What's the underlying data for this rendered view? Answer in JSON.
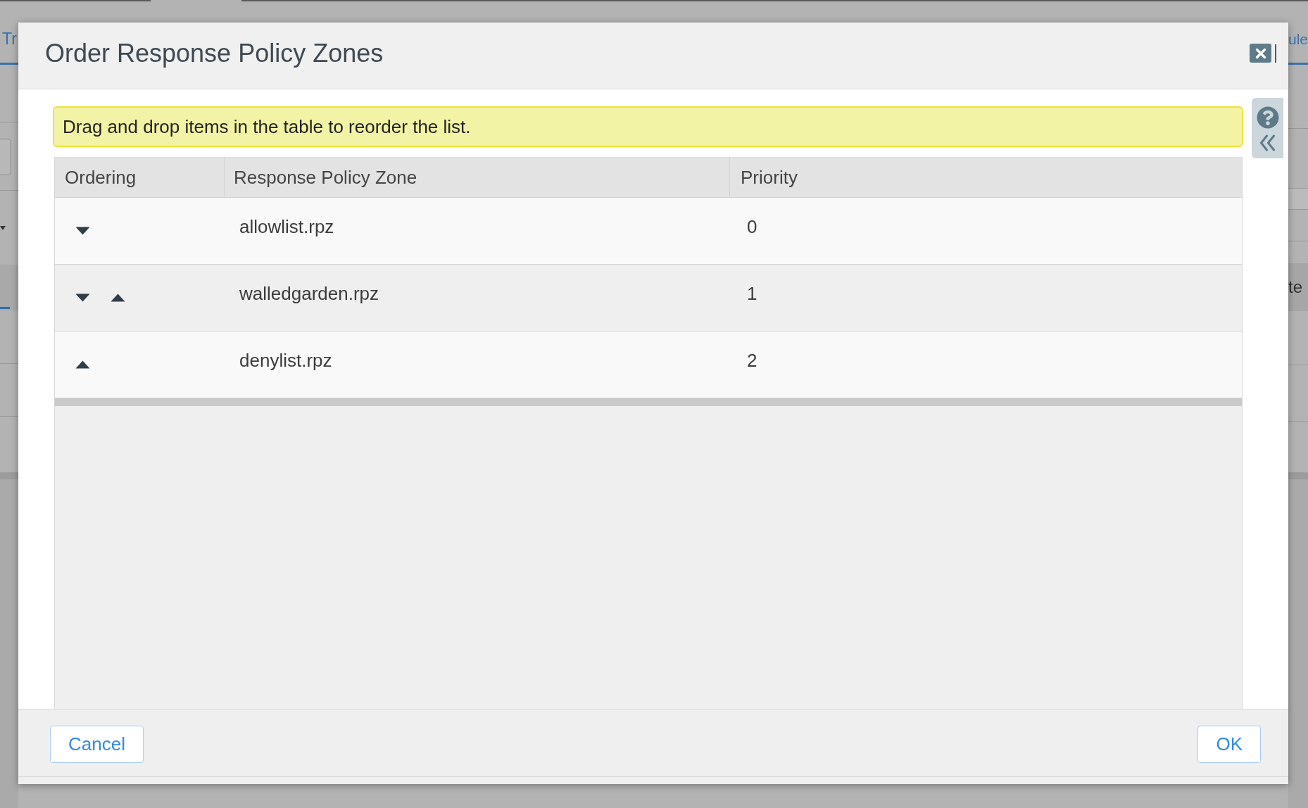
{
  "background": {
    "left_tab": "Tr",
    "right_tab": "ule",
    "right_cell": "te"
  },
  "dialog": {
    "title": "Order Response Policy Zones",
    "banner": "Drag and drop items in the table to reorder the list.",
    "table": {
      "columns": [
        "Ordering",
        "Response Policy Zone",
        "Priority"
      ],
      "rows": [
        {
          "can_move_down": true,
          "can_move_up": false,
          "zone": "allowlist.rpz",
          "priority": "0"
        },
        {
          "can_move_down": true,
          "can_move_up": true,
          "zone": "walledgarden.rpz",
          "priority": "1"
        },
        {
          "can_move_down": false,
          "can_move_up": true,
          "zone": "denylist.rpz",
          "priority": "2"
        }
      ]
    },
    "buttons": [
      {
        "label": "Cancel"
      },
      {
        "label": "OK"
      }
    ]
  }
}
